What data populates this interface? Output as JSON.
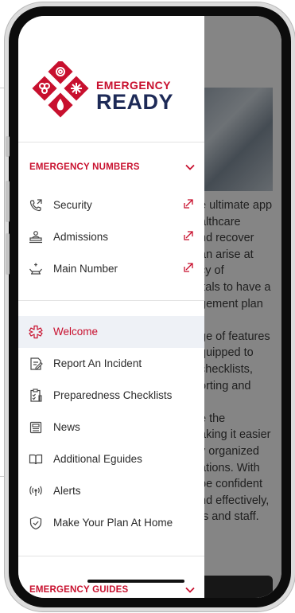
{
  "colors": {
    "brand_red": "#c8102e",
    "brand_navy": "#1d2a57",
    "icon_gray": "#444444"
  },
  "logo": {
    "line1": "EMERGENCY",
    "line2": "READY"
  },
  "emergency_numbers": {
    "title": "EMERGENCY NUMBERS",
    "items": [
      {
        "label": "Security",
        "icon": "phone-forward-icon"
      },
      {
        "label": "Admissions",
        "icon": "admissions-desk-icon"
      },
      {
        "label": "Main Number",
        "icon": "hospital-bed-icon"
      }
    ]
  },
  "menu": {
    "items": [
      {
        "label": "Welcome",
        "icon": "medical-cross-icon",
        "active": true
      },
      {
        "label": "Report An Incident",
        "icon": "report-incident-icon"
      },
      {
        "label": "Preparedness Checklists",
        "icon": "checklist-icon"
      },
      {
        "label": "News",
        "icon": "newspaper-icon"
      },
      {
        "label": "Additional Eguides",
        "icon": "open-book-icon"
      },
      {
        "label": "Alerts",
        "icon": "broadcast-icon"
      },
      {
        "label": "Make Your Plan At Home",
        "icon": "shield-icon"
      }
    ]
  },
  "emergency_guides": {
    "title": "EMERGENCY GUIDES"
  },
  "background_text": [
    "e ultimate app",
    "althcare",
    "nd recover",
    "an arise at",
    "cy of",
    "itals to have a",
    "gement plan",
    "",
    "ge of features",
    "quipped to",
    "checklists,",
    "orting and",
    "",
    "e the",
    "aking it easier",
    "y organized",
    "ations. With",
    "be confident",
    "nd effectively,",
    "ts and staff."
  ]
}
